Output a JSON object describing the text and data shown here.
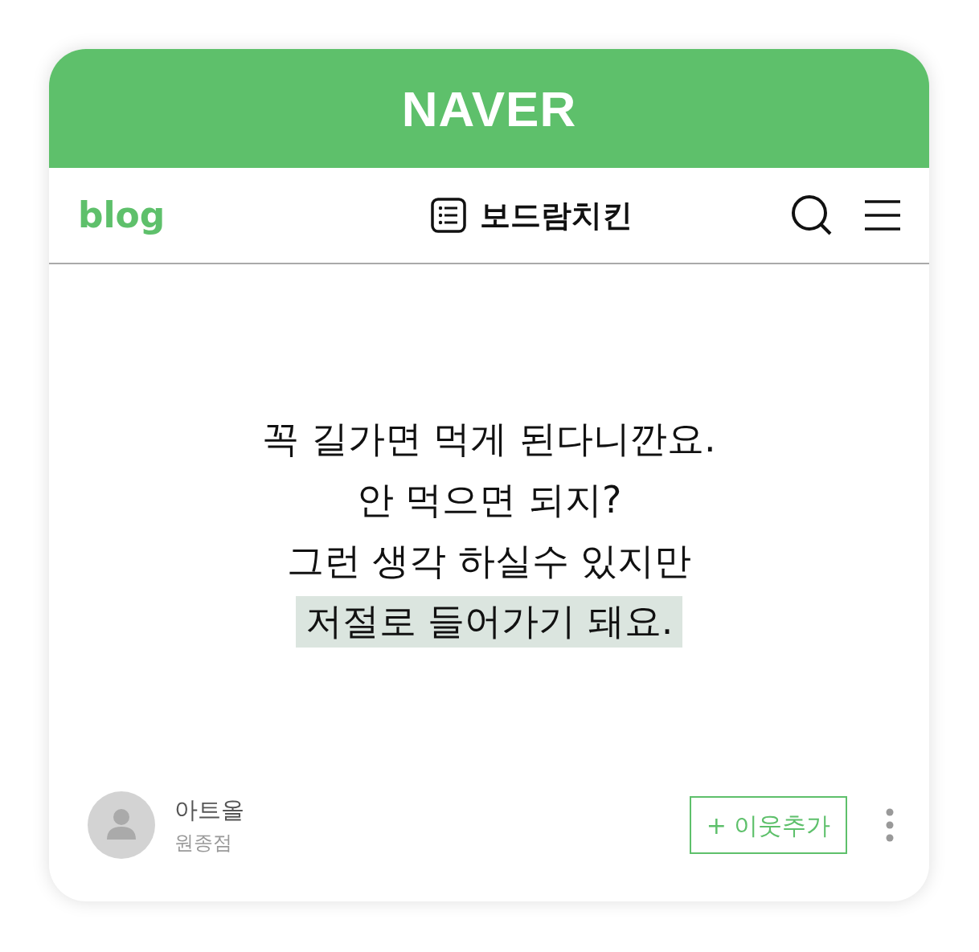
{
  "header": {
    "logo": "NAVER"
  },
  "nav": {
    "logo": "blog",
    "title": "보드람치킨"
  },
  "post": {
    "lines": [
      {
        "text": "꼭 길가면 먹게 된다니깐요.",
        "highlighted": false
      },
      {
        "text": "안 먹으면 되지?",
        "highlighted": false
      },
      {
        "text": "그런 생각 하실수 있지만",
        "highlighted": false
      },
      {
        "text": "저절로 들어가기 돼요.",
        "highlighted": true
      }
    ]
  },
  "author": {
    "name": "아트올",
    "subtitle": "원종점"
  },
  "follow_button": "+ 이웃추가"
}
